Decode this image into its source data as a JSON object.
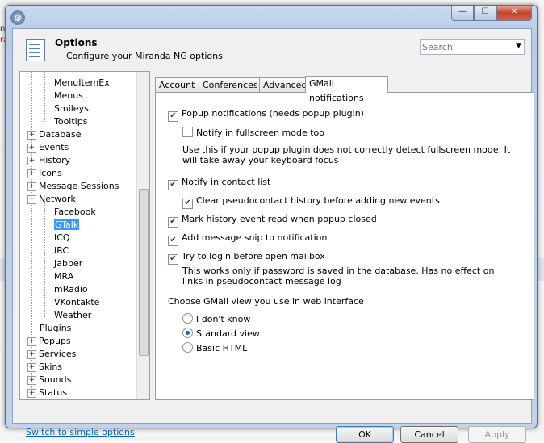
{
  "header": {
    "title": "Options",
    "subtitle": "Configure your Miranda NG options",
    "search_placeholder": "Search"
  },
  "tree": {
    "items": [
      {
        "label": "MenuItemEx",
        "level": 2
      },
      {
        "label": "Menus",
        "level": 2
      },
      {
        "label": "Smileys",
        "level": 2
      },
      {
        "label": "Tooltips",
        "level": 2
      },
      {
        "label": "Database",
        "level": 1,
        "expander": "+"
      },
      {
        "label": "Events",
        "level": 1,
        "expander": "+"
      },
      {
        "label": "History",
        "level": 1,
        "expander": "+"
      },
      {
        "label": "Icons",
        "level": 1,
        "expander": "+"
      },
      {
        "label": "Message Sessions",
        "level": 1,
        "expander": "+"
      },
      {
        "label": "Network",
        "level": 1,
        "expander": "−"
      },
      {
        "label": "Facebook",
        "level": 2
      },
      {
        "label": "GTalk",
        "level": 2,
        "selected": true
      },
      {
        "label": "ICQ",
        "level": 2
      },
      {
        "label": "IRC",
        "level": 2
      },
      {
        "label": "Jabber",
        "level": 2
      },
      {
        "label": "MRA",
        "level": 2
      },
      {
        "label": "mRadio",
        "level": 2
      },
      {
        "label": "VKontakte",
        "level": 2
      },
      {
        "label": "Weather",
        "level": 2
      },
      {
        "label": "Plugins",
        "level": 1
      },
      {
        "label": "Popups",
        "level": 1,
        "expander": "+"
      },
      {
        "label": "Services",
        "level": 1,
        "expander": "+"
      },
      {
        "label": "Skins",
        "level": 1,
        "expander": "+"
      },
      {
        "label": "Sounds",
        "level": 1,
        "expander": "+"
      },
      {
        "label": "Status",
        "level": 1,
        "expander": "+"
      }
    ]
  },
  "tabs": [
    {
      "label": "Account"
    },
    {
      "label": "Conferences"
    },
    {
      "label": "Advanced"
    },
    {
      "label": "GMail notifications",
      "active": true
    }
  ],
  "gmail": {
    "popup_notifications": {
      "label": "Popup notifications (needs popup plugin)",
      "checked": true
    },
    "notify_fullscreen": {
      "label": "Notify in fullscreen mode too",
      "checked": false
    },
    "fullscreen_note": "Use this if your popup plugin does not correctly detect fullscreen mode. It will take away your keyboard focus",
    "notify_contact_list": {
      "label": "Notify in contact list",
      "checked": true
    },
    "clear_history": {
      "label": "Clear pseudocontact history before adding new events",
      "checked": true
    },
    "mark_read": {
      "label": "Mark history event read when popup closed",
      "checked": true
    },
    "add_snip": {
      "label": "Add message snip to notification",
      "checked": true
    },
    "try_login": {
      "label": "Try to login before open mailbox",
      "checked": true
    },
    "login_note": "This works only if password is saved in the database. Has no effect on links in pseudocontact message log",
    "view_heading": "Choose GMail view you use in web interface",
    "views": [
      {
        "label": "I don't know",
        "selected": false
      },
      {
        "label": "Standard view",
        "selected": true
      },
      {
        "label": "Basic HTML",
        "selected": false
      }
    ]
  },
  "footer": {
    "simple_link": "Switch to simple options",
    "ok": "OK",
    "cancel": "Cancel",
    "apply": "Apply"
  },
  "window_buttons": {
    "minimize": "—",
    "maximize": "☐",
    "close": "✕"
  },
  "background": {
    "red_text": "randa",
    "black_text": "nda"
  }
}
